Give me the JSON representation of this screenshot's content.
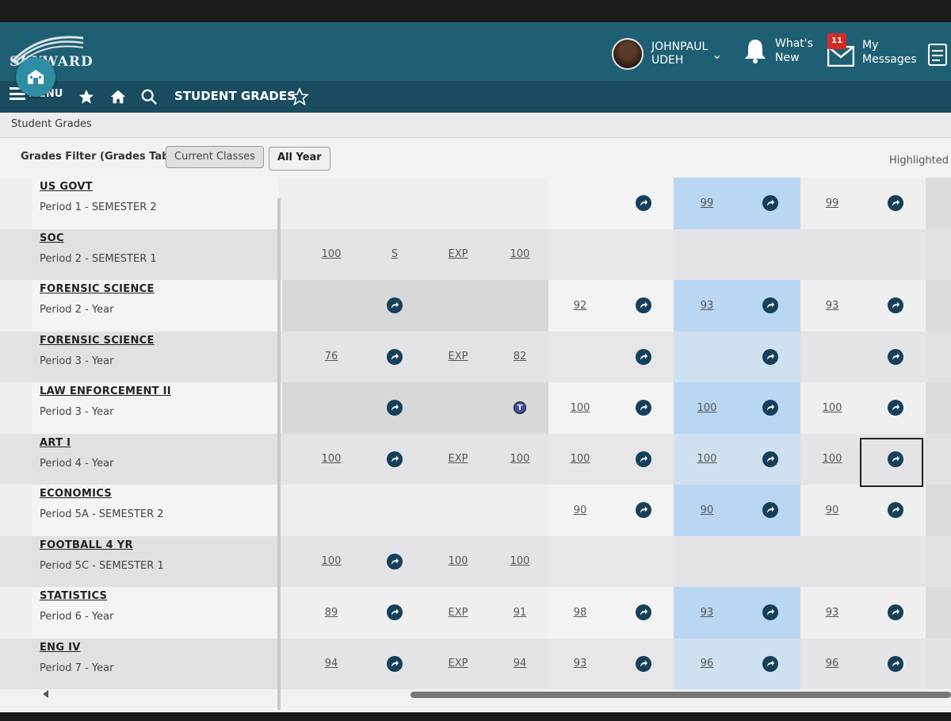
{
  "header": {
    "logo_text": "SKYWARD",
    "user_name": "JOHNPAUL UDEH",
    "whats_new": "What's New",
    "messages_label": "My Messages",
    "messages_count": "11"
  },
  "nav": {
    "menu_label": "MENU",
    "page_title": "STUDENT GRADES"
  },
  "breadcrumb": "Student Grades",
  "filter": {
    "label": "Grades Filter (Grades Tab)",
    "current_classes": "Current Classes",
    "all_year": "All Year",
    "highlighted": "Highlighted"
  },
  "courses": [
    {
      "name": "US GOVT",
      "period": "Period 1 - SEMESTER 2"
    },
    {
      "name": "SOC",
      "period": "Period 2 - SEMESTER 1"
    },
    {
      "name": "FORENSIC SCIENCE",
      "period": "Period 2 - Year"
    },
    {
      "name": "FORENSIC SCIENCE",
      "period": "Period 3 - Year"
    },
    {
      "name": "LAW ENFORCEMENT II",
      "period": "Period 3 - Year"
    },
    {
      "name": "ART I",
      "period": "Period 4 - Year"
    },
    {
      "name": "ECONOMICS",
      "period": "Period 5A - SEMESTER 2"
    },
    {
      "name": "FOOTBALL 4 YR",
      "period": "Period 5C - SEMESTER 1"
    },
    {
      "name": "STATISTICS",
      "period": "Period 6 - Year"
    },
    {
      "name": "ENG IV",
      "period": "Period 7 - Year"
    }
  ],
  "grades": [
    [
      "",
      "",
      "",
      "",
      "",
      "go",
      "99",
      "go",
      "99",
      "go"
    ],
    [
      "100",
      "S",
      "EXP",
      "100",
      "",
      "",
      "",
      "",
      "",
      ""
    ],
    [
      "",
      "go",
      "",
      "",
      "92",
      "go",
      "93",
      "go",
      "93",
      "go"
    ],
    [
      "76",
      "go",
      "EXP",
      "82",
      "",
      "go",
      "",
      "go",
      "",
      "go"
    ],
    [
      "",
      "go",
      "",
      "T",
      "100",
      "go",
      "100",
      "go",
      "100",
      "go"
    ],
    [
      "100",
      "go",
      "EXP",
      "100",
      "100",
      "go",
      "100",
      "go",
      "100",
      "go"
    ],
    [
      "",
      "",
      "",
      "",
      "90",
      "go",
      "90",
      "go",
      "90",
      "go"
    ],
    [
      "100",
      "go",
      "100",
      "100",
      "",
      "",
      "",
      "",
      "",
      ""
    ],
    [
      "89",
      "go",
      "EXP",
      "91",
      "98",
      "go",
      "93",
      "go",
      "93",
      "go"
    ],
    [
      "94",
      "go",
      "EXP",
      "94",
      "93",
      "go",
      "96",
      "go",
      "96",
      "go"
    ]
  ],
  "colors": {
    "header_bg": "#1f5f74",
    "nav_bg": "#184c5e",
    "highlight_col": "#b9d6f2",
    "icon": "#15405a"
  }
}
